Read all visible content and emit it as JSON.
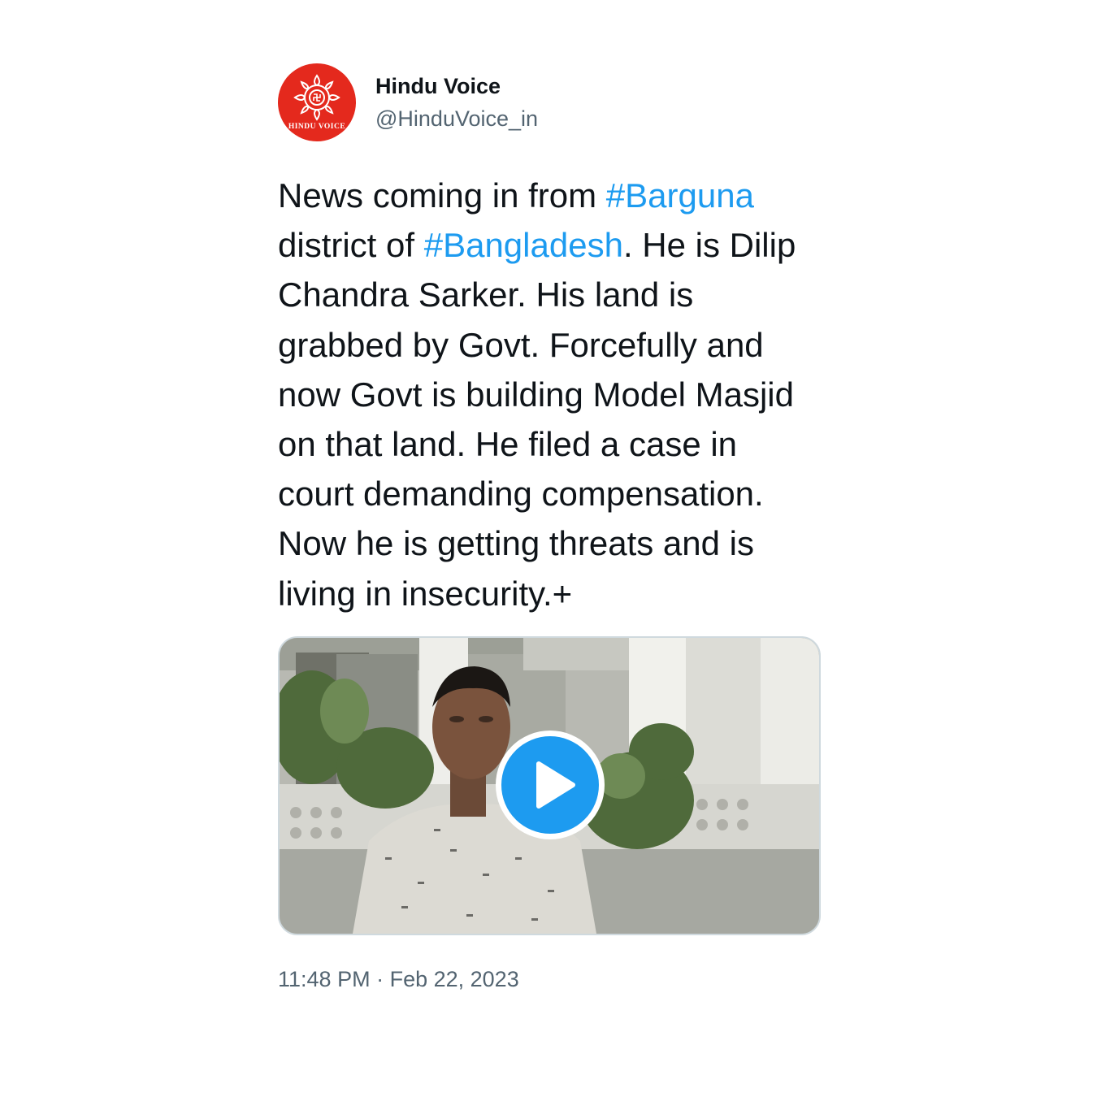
{
  "tweet": {
    "author": {
      "display_name": "Hindu Voice",
      "handle": "@HinduVoice_in",
      "avatar_logo_text": "HINDU VOICE",
      "avatar_icon": "hindu-voice-logo-icon"
    },
    "text": {
      "part1": "News coming in from ",
      "hashtag1": "#Barguna",
      "part2": " district of ",
      "hashtag2": "#Bangladesh",
      "part3": ". He is Dilip Chandra Sarker. His land is grabbed by Govt. Forcefully and now Govt is building Model Masjid on that land. He filed a case in court demanding compensation. Now he is getting threats and is living in insecurity.+"
    },
    "media": {
      "type": "video",
      "play_icon": "play-icon"
    },
    "timestamp": {
      "time": "11:48 PM",
      "separator": " · ",
      "date": "Feb 22, 2023"
    }
  },
  "colors": {
    "text": "#0f1419",
    "secondary_text": "#536471",
    "hashtag": "#1d9bf0",
    "play_button": "#1d9bf0",
    "avatar_background": "#e4291d",
    "media_border": "#cfd9de"
  }
}
